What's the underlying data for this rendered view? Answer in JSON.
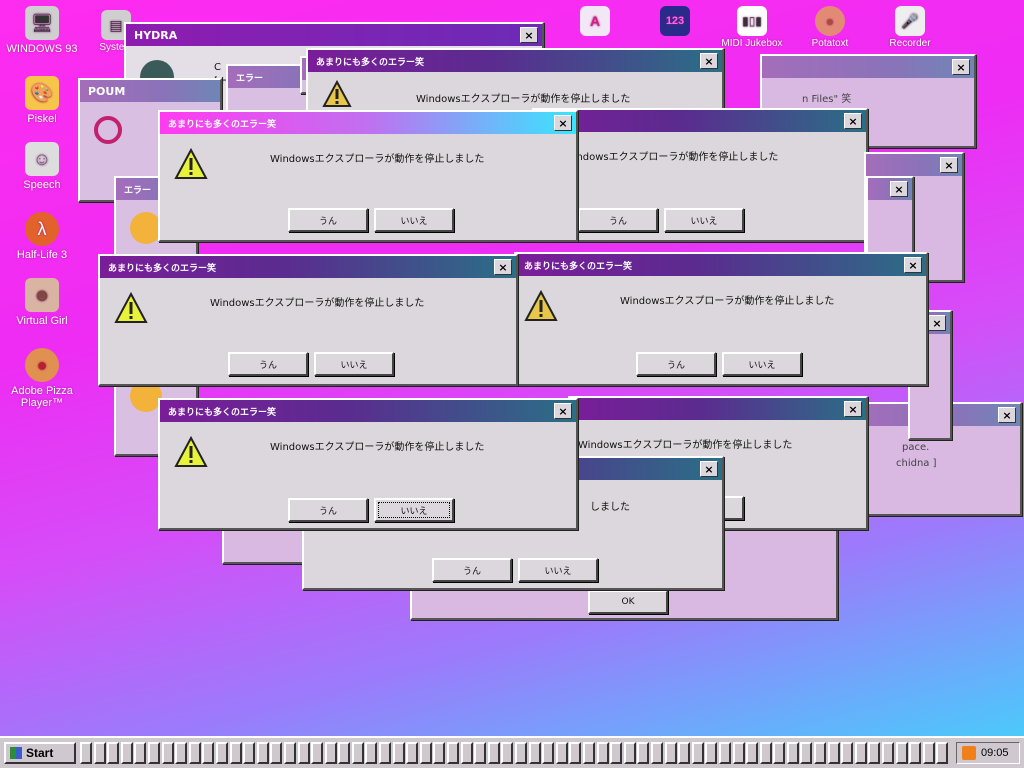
{
  "desktop_icons": [
    {
      "label": "WINDOWS 93",
      "icon": "computer-icon"
    },
    {
      "label": "Piskel",
      "icon": "palette-icon"
    },
    {
      "label": "Speech",
      "icon": "face-icon"
    },
    {
      "label": "Half-Life 3",
      "icon": "lambda-icon"
    },
    {
      "label": "Virtual Girl",
      "icon": "portrait-icon"
    },
    {
      "label": "Adobe Pizza Player™",
      "icon": "pizza-icon"
    }
  ],
  "desktop_top_icons": [
    {
      "label": "System",
      "icon": "system-icon"
    },
    {
      "label": "",
      "icon": "font-icon"
    },
    {
      "label": "",
      "icon": "numbers-icon"
    },
    {
      "label": "MIDI Jukebox",
      "icon": "piano-icon"
    },
    {
      "label": "Potatoxt",
      "icon": "potato-icon"
    },
    {
      "label": "Recorder",
      "icon": "microphone-icon"
    }
  ],
  "hydra_window": {
    "title": "HYDRA",
    "text_fragment": "C",
    "text_fragment2": "[ H"
  },
  "poum_window": {
    "title": "POUM"
  },
  "error_small_title": "エラー",
  "dialog": {
    "title": "あまりにも多くのエラー笑",
    "message": "Windowsエクスプローラが動作を停止しました",
    "yes_label": "うん",
    "no_label": "いいえ",
    "close_glyph": "×",
    "ok_label": "OK"
  },
  "background_fragments": {
    "files_text": "n Files\" 笑",
    "space_text": "pace.",
    "echidna_text": "chidna ]",
    "message_tail": "しました",
    "cont_text": "Cont"
  },
  "taskbar": {
    "start_label": "Start",
    "clock": "09:05",
    "slot_count": 64
  }
}
